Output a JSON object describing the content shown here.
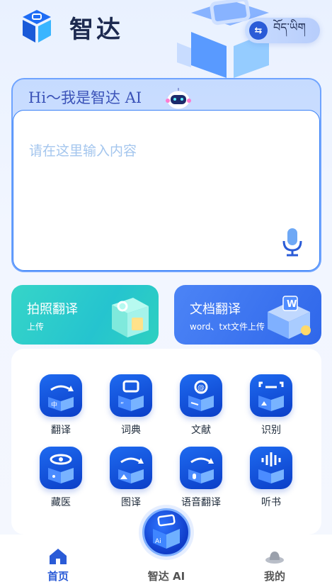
{
  "header": {
    "app_name": "智达",
    "language_label": "བོད་ཡིག"
  },
  "input_card": {
    "greeting": "Hi～我是智达 AI",
    "placeholder": "请在这里输入内容"
  },
  "actions": {
    "photo": {
      "title": "拍照翻译",
      "subtitle": "上传"
    },
    "document": {
      "title": "文档翻译",
      "subtitle": "word、txt文件上传"
    }
  },
  "grid": {
    "items": [
      {
        "label": "翻译",
        "icon": "translate-icon"
      },
      {
        "label": "词典",
        "icon": "dictionary-icon"
      },
      {
        "label": "文献",
        "icon": "literature-icon"
      },
      {
        "label": "识别",
        "icon": "recognize-icon"
      },
      {
        "label": "藏医",
        "icon": "tibetan-medicine-icon"
      },
      {
        "label": "图译",
        "icon": "image-translate-icon"
      },
      {
        "label": "语音翻译",
        "icon": "voice-translate-icon"
      },
      {
        "label": "听书",
        "icon": "audiobook-icon"
      }
    ]
  },
  "nav": {
    "home": "首页",
    "ai": "智达 AI",
    "mine": "我的",
    "fab_text": "Ai"
  },
  "colors": {
    "primary": "#2a5bd7",
    "teal": "#2fcfc6",
    "icon_bg": "#1452e0"
  }
}
